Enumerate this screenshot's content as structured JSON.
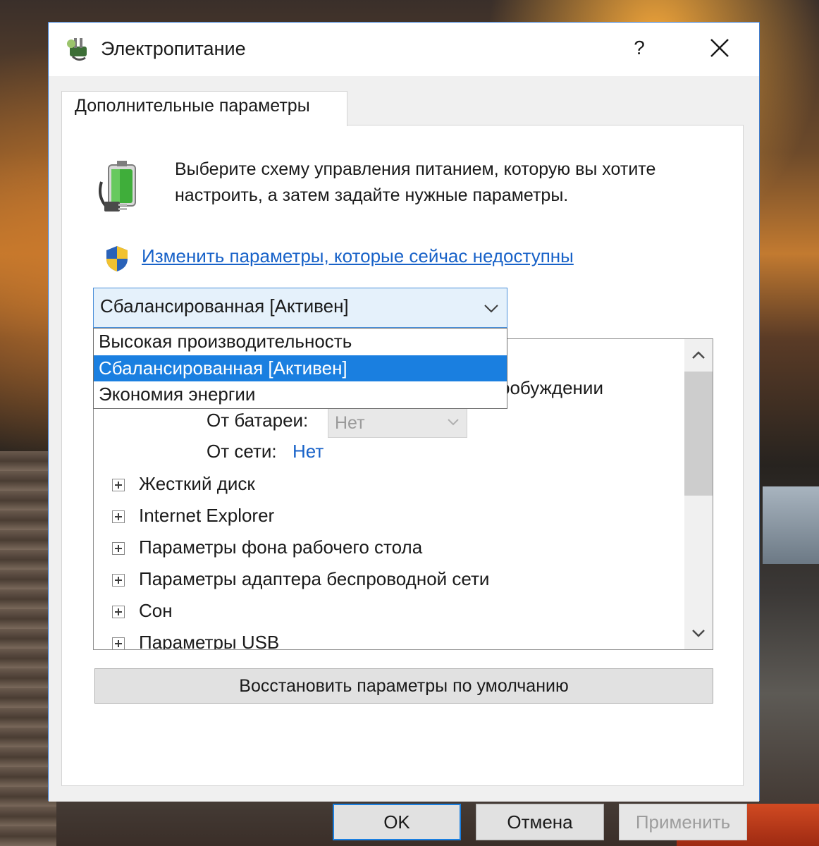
{
  "window": {
    "title": "Электропитание",
    "help_label": "?",
    "accent_color": "#1a7fe0"
  },
  "tab": {
    "label": "Дополнительные параметры"
  },
  "description": "Выберите схему управления питанием, которую вы хотите настроить, а затем задайте нужные параметры.",
  "change_link": "Изменить параметры, которые сейчас недоступны",
  "plan_select": {
    "value": "Сбалансированная [Активен]",
    "options": [
      "Высокая производительность",
      "Сбалансированная [Активен]",
      "Экономия энергии"
    ],
    "selected_index": 1
  },
  "settings_tree": {
    "partial_item": "робуждении",
    "battery_label": "От батареи:",
    "battery_value": "Нет",
    "ac_label": "От сети:",
    "ac_value": "Нет",
    "items": [
      "Жесткий диск",
      "Internet Explorer",
      "Параметры фона рабочего стола",
      "Параметры адаптера беспроводной сети",
      "Сон",
      "Параметры USB"
    ]
  },
  "restore_button": "Восстановить параметры по умолчанию",
  "buttons": {
    "ok": "OK",
    "cancel": "Отмена",
    "apply": "Применить"
  }
}
